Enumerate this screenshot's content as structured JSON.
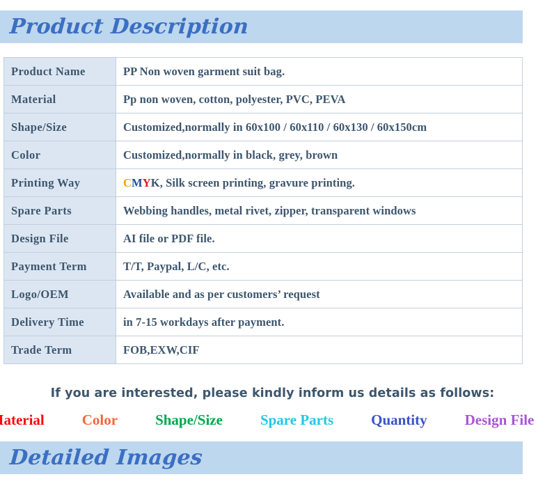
{
  "sections": {
    "product_description": {
      "title": "Product Description"
    },
    "detailed_images": {
      "title": "Detailed Images"
    }
  },
  "spec_table": {
    "rows": [
      {
        "label": "Product Name",
        "value": "PP Non woven garment suit bag."
      },
      {
        "label": "Material",
        "value": "Pp non woven, cotton, polyester, PVC, PEVA"
      },
      {
        "label": "Shape/Size",
        "value": "Customized,normally in 60x100 / 60x110 / 60x130 / 60x150cm"
      },
      {
        "label": "Color",
        "value": "Customized,normally in black, grey, brown"
      },
      {
        "label": "Printing Way",
        "value": "CMYK, Silk screen printing, gravure printing.",
        "value_prefix_colored": "CMYK",
        "value_rest": ", Silk screen printing, gravure printing."
      },
      {
        "label": "Spare Parts",
        "value": "Webbing handles, metal rivet, zipper, transparent windows"
      },
      {
        "label": "Design File",
        "value": "AI file or PDF file."
      },
      {
        "label": "Payment Term",
        "value": "T/T, Paypal, L/C, etc."
      },
      {
        "label": "Logo/OEM",
        "value": "Available and as per customers’ request"
      },
      {
        "label": "Delivery Time",
        "value": "in 7-15 workdays after payment."
      },
      {
        "label": "Trade Term",
        "value": "FOB,EXW,CIF"
      }
    ]
  },
  "cmyk": {
    "c": "C",
    "m": "M",
    "y": "Y",
    "k": "K",
    "rest": ", Silk screen printing, gravure printing.",
    "colors": {
      "c": "#f0a500",
      "m": "#1f4e9c",
      "y": "#e01b1b",
      "k": "#3d566e"
    }
  },
  "interest": {
    "text": "If you are interested, please kindly inform us details as follows:"
  },
  "keywords": [
    {
      "label": "Material",
      "color": "#fa0a0a"
    },
    {
      "label": "Color",
      "color": "#f4663a"
    },
    {
      "label": "Shape/Size",
      "color": "#00a84a"
    },
    {
      "label": "Spare Parts",
      "color": "#22c8e8"
    },
    {
      "label": "Quantity",
      "color": "#3a52c8"
    },
    {
      "label": "Design File",
      "color": "#a855d8"
    }
  ],
  "theme": {
    "banner_bg": "#bdd7ee",
    "banner_text": "#3b6fc4",
    "label_cell_bg": "#dce6f2",
    "table_border": "#c3cfdd",
    "body_text": "#3d566e",
    "page_bg": "#ffffff"
  }
}
